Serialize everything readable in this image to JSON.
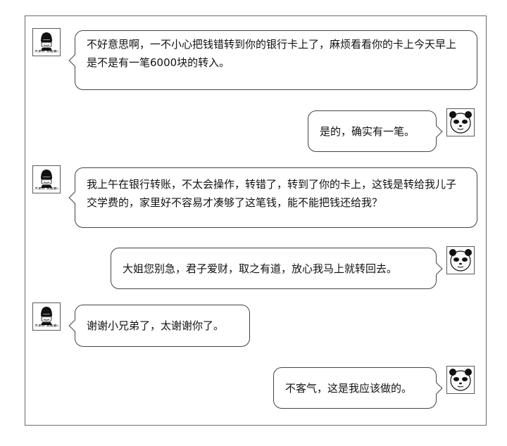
{
  "avatars": {
    "man_caption": "大家好 我是骗子",
    "man_icon": "masked-thief-meme-icon",
    "panda_icon": "panda-face-meme-icon"
  },
  "messages": [
    {
      "side": "left",
      "sender": "scammer",
      "text": "不好意思啊，一不小心把钱错转到你的银行卡上了，麻烦看看你的卡上今天早上是不是有一笔6000块的转入。"
    },
    {
      "side": "right",
      "sender": "panda",
      "text": "是的，确实有一笔。"
    },
    {
      "side": "left",
      "sender": "scammer",
      "text": "我上午在银行转账，不太会操作，转错了，转到了你的卡上，这钱是转给我儿子交学费的，家里好不容易才凑够了这笔钱，能不能把钱还给我？"
    },
    {
      "side": "right",
      "sender": "panda",
      "text": "大姐您别急，君子爱财，取之有道，放心我马上就转回去。"
    },
    {
      "side": "left",
      "sender": "scammer",
      "text": "谢谢小兄弟了，太谢谢你了。"
    },
    {
      "side": "right",
      "sender": "panda",
      "text": "不客气，这是我应该做的。"
    }
  ]
}
